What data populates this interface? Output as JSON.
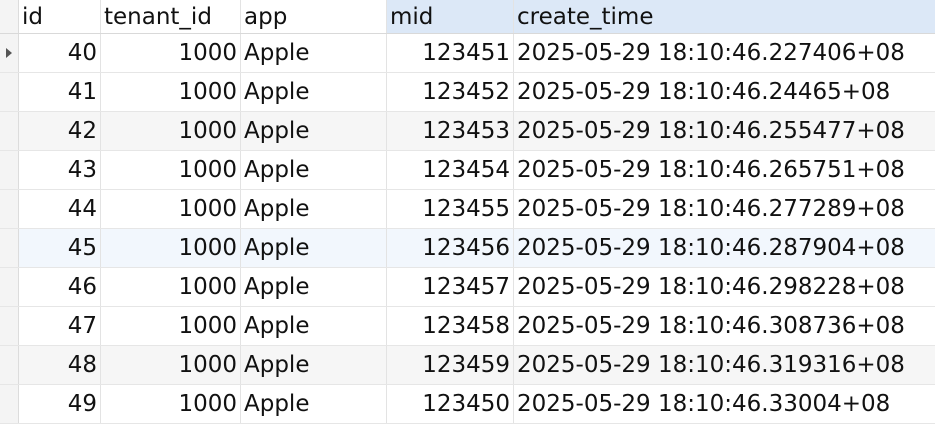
{
  "columns": [
    "id",
    "tenant_id",
    "app",
    "mid",
    "create_time"
  ],
  "rows": [
    {
      "id": "40",
      "tenant_id": "1000",
      "app": "Apple",
      "mid": "123451",
      "create_time": "2025-05-29 18:10:46.227406+08"
    },
    {
      "id": "41",
      "tenant_id": "1000",
      "app": "Apple",
      "mid": "123452",
      "create_time": "2025-05-29 18:10:46.24465+08"
    },
    {
      "id": "42",
      "tenant_id": "1000",
      "app": "Apple",
      "mid": "123453",
      "create_time": "2025-05-29 18:10:46.255477+08"
    },
    {
      "id": "43",
      "tenant_id": "1000",
      "app": "Apple",
      "mid": "123454",
      "create_time": "2025-05-29 18:10:46.265751+08"
    },
    {
      "id": "44",
      "tenant_id": "1000",
      "app": "Apple",
      "mid": "123455",
      "create_time": "2025-05-29 18:10:46.277289+08"
    },
    {
      "id": "45",
      "tenant_id": "1000",
      "app": "Apple",
      "mid": "123456",
      "create_time": "2025-05-29 18:10:46.287904+08"
    },
    {
      "id": "46",
      "tenant_id": "1000",
      "app": "Apple",
      "mid": "123457",
      "create_time": "2025-05-29 18:10:46.298228+08"
    },
    {
      "id": "47",
      "tenant_id": "1000",
      "app": "Apple",
      "mid": "123458",
      "create_time": "2025-05-29 18:10:46.308736+08"
    },
    {
      "id": "48",
      "tenant_id": "1000",
      "app": "Apple",
      "mid": "123459",
      "create_time": "2025-05-29 18:10:46.319316+08"
    },
    {
      "id": "49",
      "tenant_id": "1000",
      "app": "Apple",
      "mid": "123450",
      "create_time": "2025-05-29 18:10:46.33004+08"
    }
  ],
  "colors": {
    "sorted_header": "#dce8f7",
    "alt_row": "#f6f6f6",
    "hover_row": "#f2f7fd"
  },
  "icons": {
    "row_indicator": "current-row-indicator-icon"
  }
}
